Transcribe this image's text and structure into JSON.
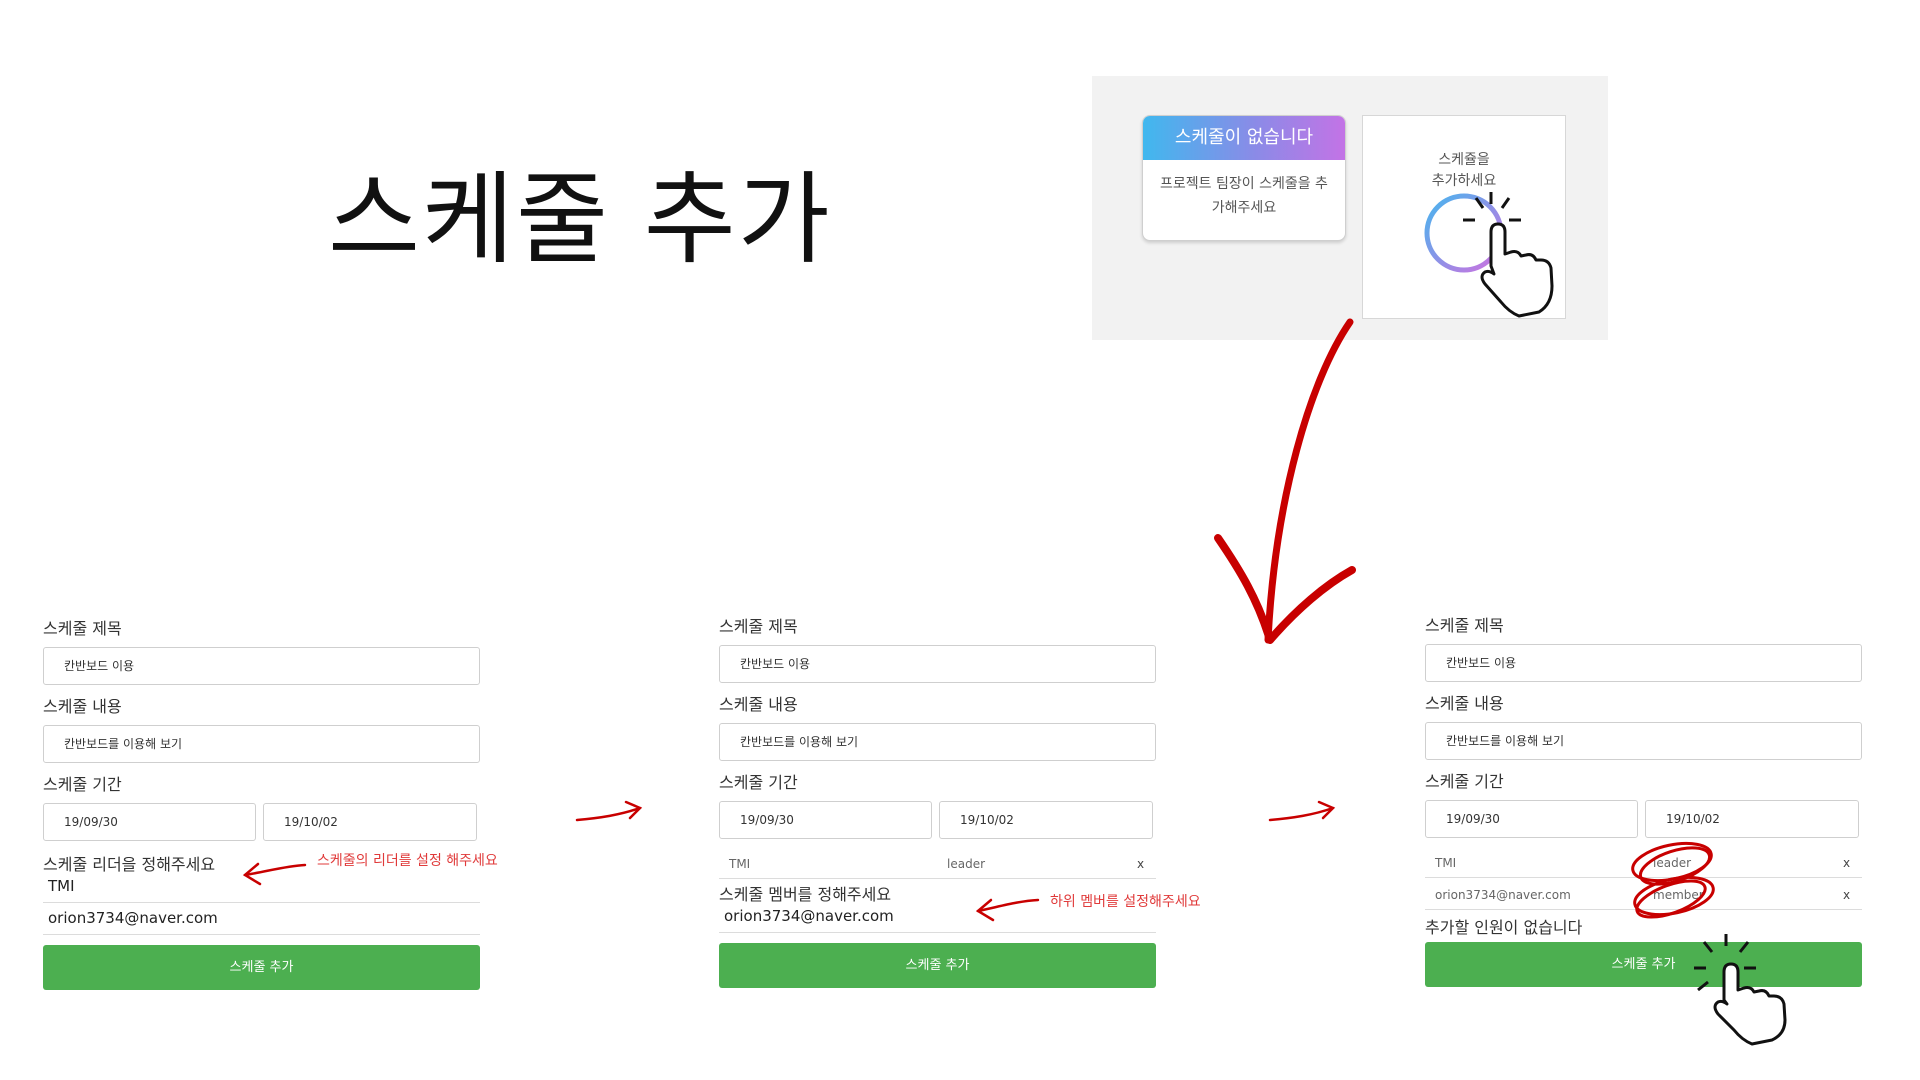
{
  "slide": {
    "title": "스케줄 추가"
  },
  "preview": {
    "empty_card_title": "스케줄이 없습니다",
    "empty_card_body": "프로젝트 팀장이 스케줄을 추가해주세요",
    "add_card_line1": "스케쥴을",
    "add_card_line2": "추가하세요"
  },
  "forms": [
    {
      "title_label": "스케줄 제목",
      "title_value": "칸반보드 이용",
      "content_label": "스케줄 내용",
      "content_value": "칸반보드를 이용해 보기",
      "period_label": "스케줄 기간",
      "start_date": "19/09/30",
      "end_date": "19/10/02",
      "leader_label": "스케줄 리더을 정해주세요",
      "option1": "TMI",
      "option2": "orion3734@naver.com",
      "submit": "스케줄 추가",
      "annotation": "스케줄의 리더를 설정 해주세요"
    },
    {
      "title_label": "스케줄 제목",
      "title_value": "칸반보드 이용",
      "content_label": "스케줄 내용",
      "content_value": "칸반보드를 이용해 보기",
      "period_label": "스케줄 기간",
      "start_date": "19/09/30",
      "end_date": "19/10/02",
      "row1_name": "TMI",
      "row1_role": "leader",
      "remove": "x",
      "member_label": "스케줄 멤버를 정해주세요",
      "option1": "orion3734@naver.com",
      "submit": "스케줄 추가",
      "annotation": "하위 멤버를 설정해주세요"
    },
    {
      "title_label": "스케줄 제목",
      "title_value": "칸반보드 이용",
      "content_label": "스케줄 내용",
      "content_value": "칸반보드를 이용해 보기",
      "period_label": "스케줄 기간",
      "start_date": "19/09/30",
      "end_date": "19/10/02",
      "row1_name": "TMI",
      "row1_role": "leader",
      "row2_name": "orion3734@naver.com",
      "row2_role": "member",
      "remove": "x",
      "empty_text": "추가할 인원이 없습니다",
      "submit": "스케줄 추가"
    }
  ],
  "colors": {
    "button_green": "#4caf50",
    "annotation_red": "#d40000"
  },
  "icons": [
    "plus-circle-icon",
    "pointer-hand-icon",
    "arrow-icon"
  ]
}
